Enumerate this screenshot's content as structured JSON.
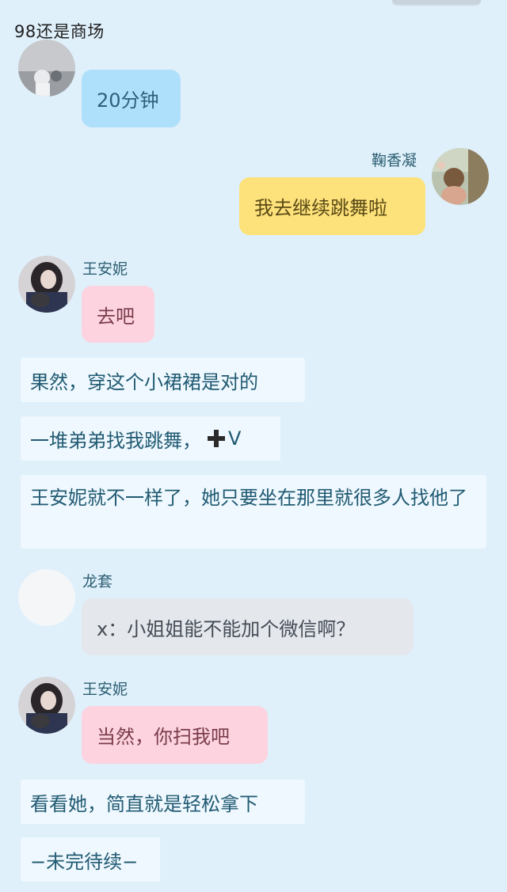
{
  "header": {
    "title": "98还是商场"
  },
  "messages": {
    "m1": {
      "text": "20分钟"
    },
    "m2": {
      "sender": "鞠香凝",
      "text": "我去继续跳舞啦"
    },
    "m3": {
      "sender": "王安妮",
      "text": "去吧"
    },
    "n1": {
      "text": "果然，穿这个小裙裙是对的"
    },
    "n2": {
      "text_before": "一堆弟弟找我跳舞，",
      "text_after": "V"
    },
    "n3": {
      "text": "王安妮就不一样了，她只要坐在那里就很多人找他了"
    },
    "m4": {
      "sender": "龙套",
      "text": "x：小姐姐能不能加个微信啊？"
    },
    "m5": {
      "sender": "王安妮",
      "text": "当然，你扫我吧"
    },
    "n4": {
      "text": "看看她，简直就是轻松拿下"
    },
    "n5": {
      "text": "−未完待续−"
    }
  },
  "icons": {
    "plus": "plus-icon"
  },
  "colors": {
    "background": "#dff0fb",
    "bubble_blue": "#aee0fb",
    "bubble_yellow": "#fde17a",
    "bubble_pink": "#fcd3de",
    "bubble_gray": "#e4e7ec",
    "narration_bg": "#eef8fe",
    "name_text": "#2d5f72"
  }
}
